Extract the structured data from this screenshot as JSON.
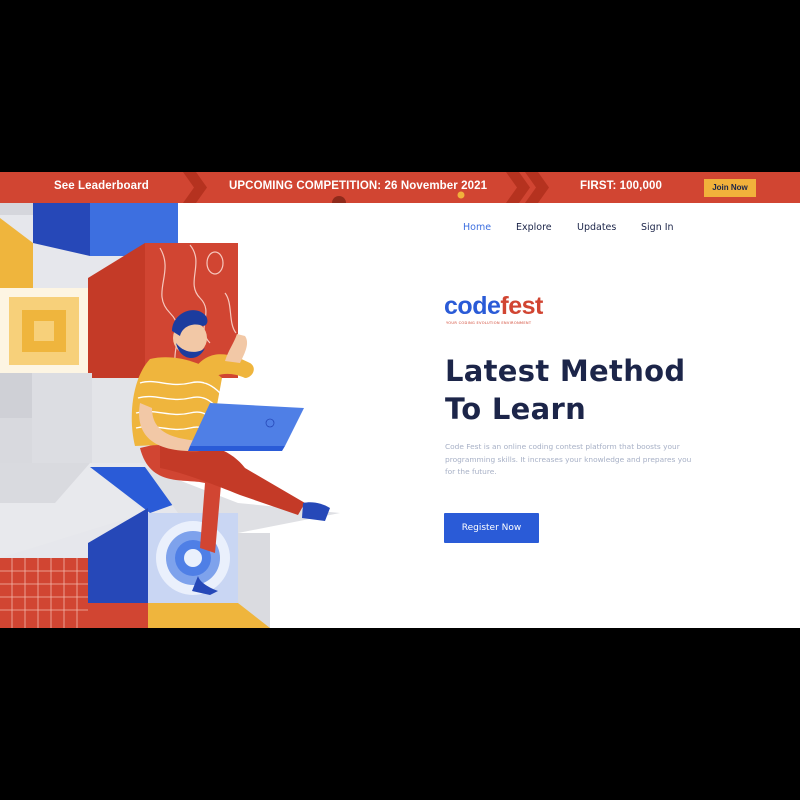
{
  "banner": {
    "leaderboard_link": "See Leaderboard",
    "competition_text": "UPCOMING COMPETITION: 26 November 2021",
    "prize_text": "FIRST: 100,000",
    "join_label": "Join Now"
  },
  "nav": {
    "items": [
      {
        "label": "Home",
        "active": true
      },
      {
        "label": "Explore",
        "active": false
      },
      {
        "label": "Updates",
        "active": false
      },
      {
        "label": "Sign In",
        "active": false
      }
    ]
  },
  "logo": {
    "part1": "c",
    "part2": "o",
    "part3": "de",
    "part4": "fest",
    "tagline": "YOUR CODING EVOLUTION ENVIRONMENT"
  },
  "hero": {
    "title_line1": "Latest Method",
    "title_line2": "To Learn",
    "description": "Code Fest is an online coding contest platform that boosts your programming skills. It increases your knowledge and prepares you for the future.",
    "cta_label": "Register Now"
  },
  "colors": {
    "primary_blue": "#2a5bd7",
    "brand_red": "#d14532",
    "accent_yellow": "#f1b13b",
    "navy": "#1c2549"
  }
}
